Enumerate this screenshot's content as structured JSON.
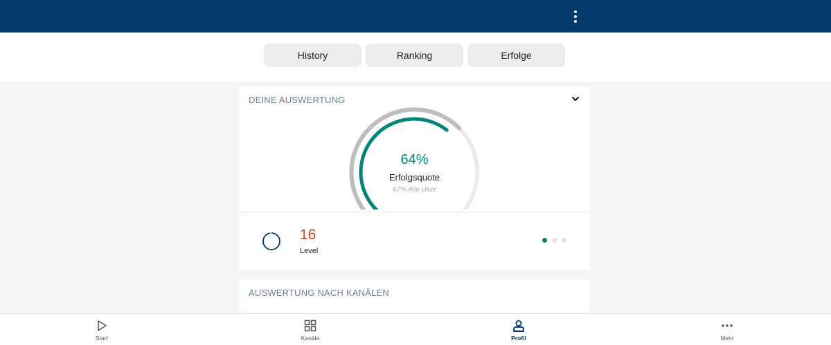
{
  "header": {
    "menu_icon": "kebab-menu-icon",
    "background_color": "#033b6c"
  },
  "tabs": [
    {
      "label": "History"
    },
    {
      "label": "Ranking"
    },
    {
      "label": "Erfolge"
    }
  ],
  "evaluation_card": {
    "title": "DEINE AUSWERTUNG",
    "expand_icon": "chevron-down-icon",
    "gauge": {
      "user_rate": 0.64,
      "all_users_rate": 0.67,
      "percent_text": "64%",
      "label": "Erfolgsquote",
      "all_users_text": "67% Alle User",
      "accent_color": "#00857a"
    },
    "level": {
      "value": "16",
      "label": "Level",
      "value_color": "#d4451f",
      "progress": 0.97
    },
    "pager": {
      "count": 3,
      "active_index": 0
    }
  },
  "channels_card": {
    "title": "AUSWERTUNG NACH KANÄLEN"
  },
  "bottom_nav": {
    "items": [
      {
        "label": "Start",
        "icon": "play-icon"
      },
      {
        "label": "Kanäle",
        "icon": "grid-icon"
      },
      {
        "label": "Profil",
        "icon": "user-icon",
        "active": true
      },
      {
        "label": "Mehr",
        "icon": "more-horizontal-icon"
      }
    ]
  }
}
